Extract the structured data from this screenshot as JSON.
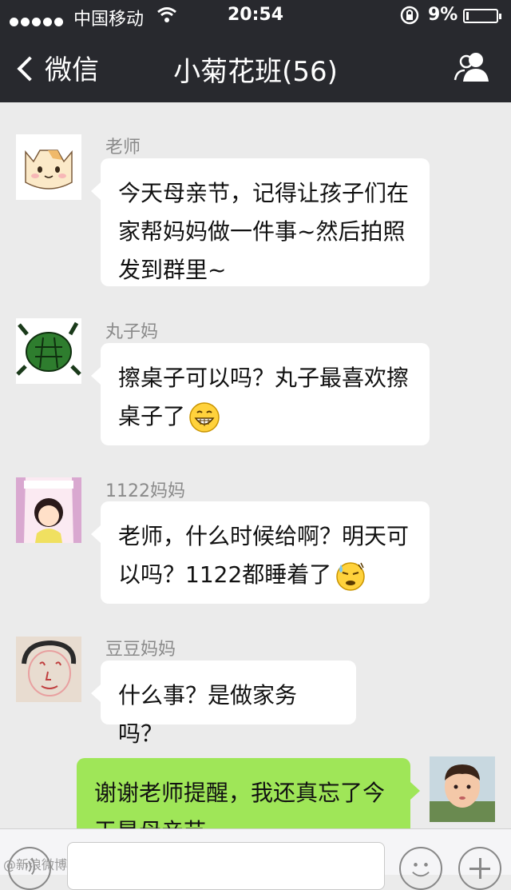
{
  "status": {
    "carrier": "中国移动",
    "time": "20:54",
    "battery": "9%",
    "battery_level": 0.09
  },
  "nav": {
    "back_label": "微信",
    "title": "小菊花班(56)"
  },
  "messages": [
    {
      "sender": "老师",
      "lines": [
        "今天母亲节，记得让孩子们在",
        "家帮妈妈做一件事~然后拍照",
        "发到群里~"
      ]
    },
    {
      "sender": "丸子妈",
      "lines": [
        "擦桌子可以吗？丸子最喜欢擦",
        "桌子了"
      ],
      "emoji": "grin-emoji-icon"
    },
    {
      "sender": "1122妈妈",
      "lines": [
        "老师，什么时候给啊？明天可",
        "以吗？1122都睡着了"
      ],
      "emoji": "sweat-emoji-icon"
    },
    {
      "sender": "豆豆妈妈",
      "lines": [
        "什么事？是做家务吗？"
      ]
    },
    {
      "sender": "me",
      "lines": [
        "谢谢老师提醒，我还真忘了今",
        "天是母亲节"
      ]
    }
  ],
  "watermark": "@新浪微博"
}
